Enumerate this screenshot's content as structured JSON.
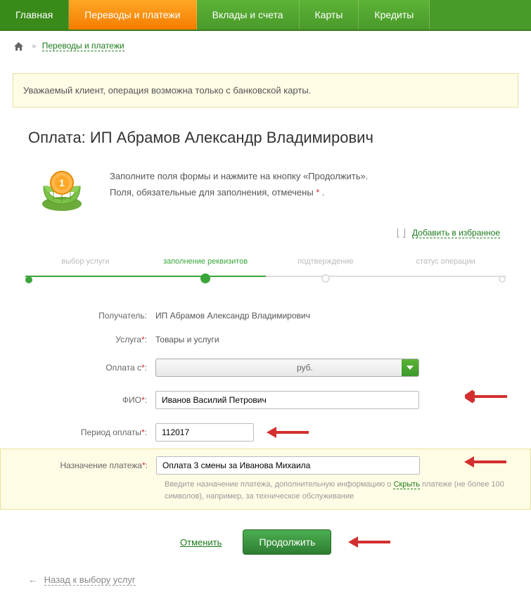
{
  "nav": {
    "items": [
      {
        "label": "Главная"
      },
      {
        "label": "Переводы и платежи",
        "active": true
      },
      {
        "label": "Вклады и счета"
      },
      {
        "label": "Карты"
      },
      {
        "label": "Кредиты"
      }
    ]
  },
  "breadcrumb": {
    "link": "Переводы и платежи"
  },
  "notice": "Уважаемый клиент, операция возможна только с банковской карты.",
  "title": "Оплата: ИП Абрамов Александр Владимирович",
  "intro": {
    "line1": "Заполните поля формы и нажмите на кнопку «Продолжить».",
    "line2_a": "Поля, обязательные для заполнения, отмечены ",
    "line2_b": "*",
    "line2_c": " ."
  },
  "favorite": "Добавить в избранное",
  "steps": [
    {
      "label": "выбор услуги"
    },
    {
      "label": "заполнение реквизитов"
    },
    {
      "label": "подтверждение"
    },
    {
      "label": "статус операции"
    }
  ],
  "form": {
    "recipient": {
      "label": "Получатель:",
      "value": "ИП Абрамов Александр Владимирович"
    },
    "service": {
      "label": "Услуга*:",
      "value": "Товары и услуги"
    },
    "payfrom": {
      "label": "Оплата с*:",
      "currency": "руб."
    },
    "fio": {
      "label": "ФИО*:",
      "value": "Иванов Василий Петрович"
    },
    "period": {
      "label": "Период оплаты*:",
      "value": "112017"
    },
    "purpose": {
      "label": "Назначение платежа*:",
      "value": "Оплата 3 смены за Иванова Михаила",
      "hint_a": "Введите назначение платежа, дополнительную информацию о ",
      "hint_link": "Скрыть",
      "hint_b": " платеже (не более 100 символов), например, за техническое обслуживание"
    }
  },
  "actions": {
    "cancel": "Отменить",
    "continue": "Продолжить"
  },
  "back": {
    "arrow": "←",
    "label": "Назад к выбору услуг"
  }
}
